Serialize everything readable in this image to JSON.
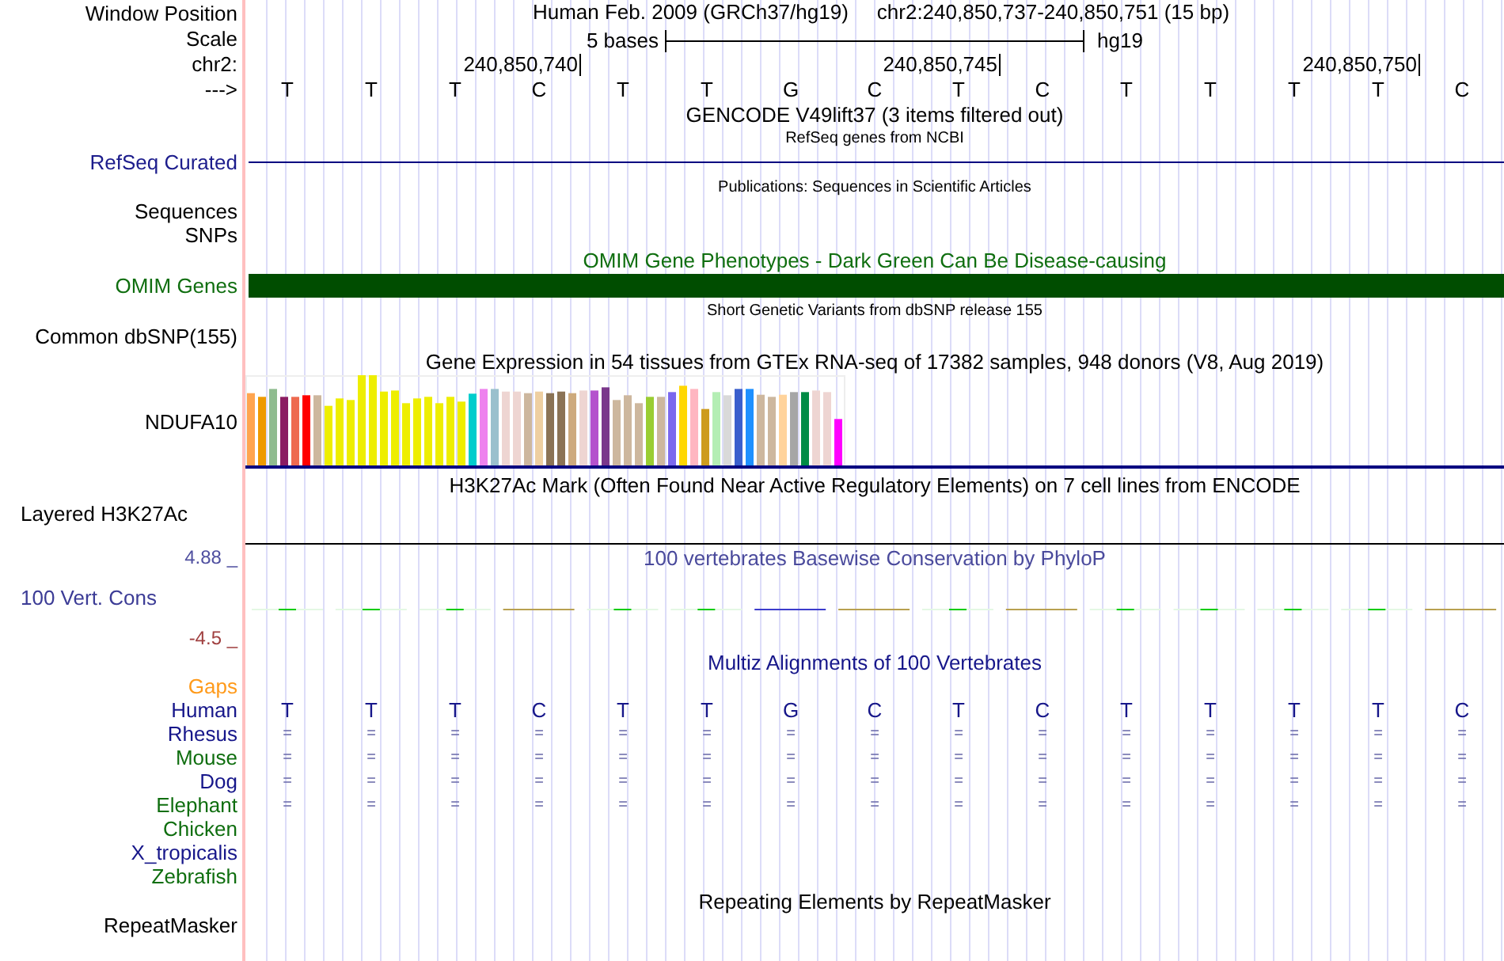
{
  "ruler": {
    "window_label": "Window Position",
    "assembly": "Human Feb. 2009 (GRCh37/hg19)",
    "position": "chr2:240,850,737-240,850,751 (15 bp)",
    "scale_label": "Scale",
    "scale_text": "5 bases",
    "scale_db": "hg19",
    "chrom_label": "chr2:",
    "strand_label": "--->",
    "bases": [
      {
        "base": "T"
      },
      {
        "base": "T"
      },
      {
        "base": "T"
      },
      {
        "base": "C",
        "tick": "240,850,740"
      },
      {
        "base": "T"
      },
      {
        "base": "T"
      },
      {
        "base": "G"
      },
      {
        "base": "C"
      },
      {
        "base": "T",
        "tick": "240,850,745"
      },
      {
        "base": "C"
      },
      {
        "base": "T"
      },
      {
        "base": "T"
      },
      {
        "base": "T"
      },
      {
        "base": "T",
        "tick": "240,850,750"
      },
      {
        "base": "C"
      }
    ]
  },
  "gencode": {
    "title": "GENCODE V49lift37 (3 items filtered out)"
  },
  "refseq": {
    "title": "RefSeq genes from NCBI",
    "label": "RefSeq Curated"
  },
  "publications": {
    "title": "Publications: Sequences in Scientific Articles",
    "label": "Sequences"
  },
  "snps": {
    "label": "SNPs"
  },
  "omim": {
    "title": "OMIM Gene Phenotypes - Dark Green Can Be Disease-causing",
    "label": "OMIM Genes"
  },
  "dbsnp": {
    "title": "Short Genetic Variants from dbSNP release 155",
    "label": "Common dbSNP(155)"
  },
  "gtex": {
    "title": "Gene Expression in 54 tissues from GTEx RNA-seq of 17382 samples, 948 donors (V8, Aug 2019)",
    "label": "NDUFA10"
  },
  "h3k27ac": {
    "title": "H3K27Ac Mark (Often Found Near Active Regulatory Elements) on 7 cell lines from ENCODE",
    "label": "Layered H3K27Ac"
  },
  "phylop": {
    "title": "100 vertebrates Basewise Conservation by PhyloP",
    "label": "100 Vert. Cons",
    "max": "4.88 _",
    "min": "-4.5 _"
  },
  "multiz": {
    "title": "Multiz Alignments of 100 Vertebrates",
    "gaps_label": "Gaps",
    "species": [
      {
        "name": "Human",
        "color": "#16168a",
        "kind": "bases",
        "cells": [
          "T",
          "T",
          "T",
          "C",
          "T",
          "T",
          "G",
          "C",
          "T",
          "C",
          "T",
          "T",
          "T",
          "T",
          "C"
        ]
      },
      {
        "name": "Rhesus",
        "color": "#16168a",
        "kind": "match",
        "cells": [
          "=",
          "=",
          "=",
          "=",
          "=",
          "=",
          "=",
          "=",
          "=",
          "=",
          "=",
          "=",
          "=",
          "=",
          "="
        ]
      },
      {
        "name": "Mouse",
        "color": "#0f6e0f",
        "kind": "match",
        "cells": [
          "=",
          "=",
          "=",
          "=",
          "=",
          "=",
          "=",
          "=",
          "=",
          "=",
          "=",
          "=",
          "=",
          "=",
          "="
        ]
      },
      {
        "name": "Dog",
        "color": "#16168a",
        "kind": "match",
        "cells": [
          "=",
          "=",
          "=",
          "=",
          "=",
          "=",
          "=",
          "=",
          "=",
          "=",
          "=",
          "=",
          "=",
          "=",
          "="
        ]
      },
      {
        "name": "Elephant",
        "color": "#0f6e0f",
        "kind": "match",
        "cells": [
          "=",
          "=",
          "=",
          "=",
          "=",
          "=",
          "=",
          "=",
          "=",
          "=",
          "=",
          "=",
          "=",
          "=",
          "="
        ]
      },
      {
        "name": "Chicken",
        "color": "#0f6e0f",
        "kind": "empty"
      },
      {
        "name": "X_tropicalis",
        "color": "#16168a",
        "kind": "empty"
      },
      {
        "name": "Zebrafish",
        "color": "#0f6e0f",
        "kind": "empty"
      }
    ]
  },
  "repeatmasker": {
    "title": "Repeating Elements by RepeatMasker",
    "label": "RepeatMasker"
  }
}
